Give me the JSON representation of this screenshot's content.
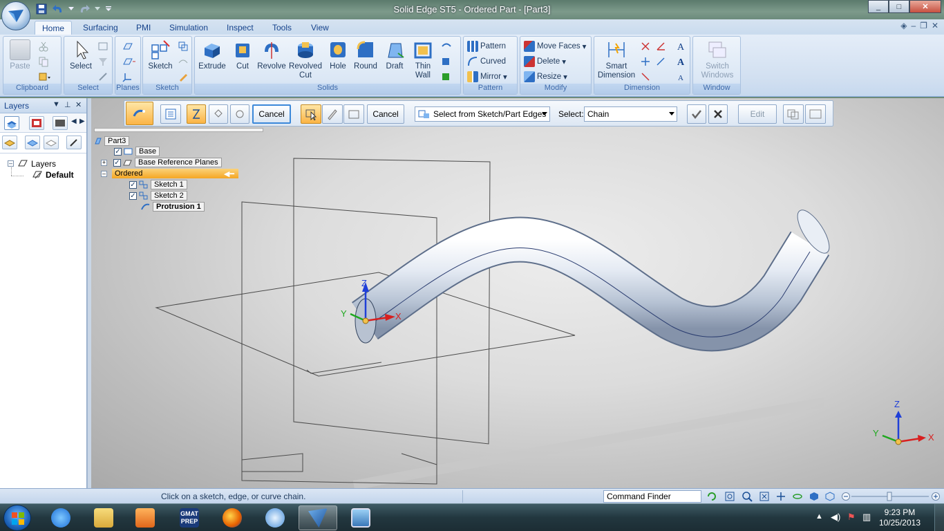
{
  "window": {
    "title": "Solid Edge ST5 - Ordered Part - [Part3]",
    "minimize": "_",
    "maximize": "□",
    "close": "✕"
  },
  "ribbon_tabs": [
    "Home",
    "Surfacing",
    "PMI",
    "Simulation",
    "Inspect",
    "Tools",
    "View"
  ],
  "ribbon": {
    "clipboard": {
      "label": "Clipboard",
      "paste": "Paste"
    },
    "select": {
      "label": "Select",
      "select": "Select"
    },
    "planes": {
      "label": "Planes"
    },
    "sketch": {
      "label": "Sketch",
      "sketch": "Sketch"
    },
    "solids": {
      "label": "Solids",
      "extrude": "Extrude",
      "cut": "Cut",
      "revolve": "Revolve",
      "revolved_cut_1": "Revolved",
      "revolved_cut_2": "Cut",
      "hole": "Hole",
      "round": "Round",
      "draft": "Draft",
      "thin_wall_1": "Thin",
      "thin_wall_2": "Wall"
    },
    "pattern": {
      "label": "Pattern",
      "pattern": "Pattern",
      "curved": "Curved",
      "mirror": "Mirror"
    },
    "modify": {
      "label": "Modify",
      "move_faces": "Move Faces",
      "delete": "Delete",
      "resize": "Resize"
    },
    "dimension": {
      "label": "Dimension",
      "smart_1": "Smart",
      "smart_2": "Dimension"
    },
    "window": {
      "label": "Window",
      "switch_1": "Switch",
      "switch_2": "Windows"
    }
  },
  "layers_pane": {
    "title": "Layers",
    "tree_root": "Layers",
    "tree_child": "Default"
  },
  "command_bar": {
    "cancel1": "Cancel",
    "cancel2": "Cancel",
    "select_source": "Select from Sketch/Part Edges",
    "select_label": "Select:",
    "select_value": "Chain",
    "edit": "Edit"
  },
  "feature_tree": {
    "root": "Part3",
    "base": "Base",
    "base_planes": "Base Reference Planes",
    "ordered": "Ordered",
    "sketch1": "Sketch 1",
    "sketch2": "Sketch 2",
    "protrusion": "Protrusion 1"
  },
  "triad": {
    "x": "X",
    "y": "Y",
    "z": "Z"
  },
  "status": {
    "message": "Click on a sketch, edge, or curve chain.",
    "command_finder": "Command Finder"
  },
  "taskbar": {
    "time": "9:23 PM",
    "date": "10/25/2013",
    "gmat_line1": "GMAT",
    "gmat_line2": "PREP"
  },
  "colors": {
    "accent": "#fbb445",
    "ribbon": "#dbe7f5",
    "ordered_highlight": "#f5a623"
  }
}
